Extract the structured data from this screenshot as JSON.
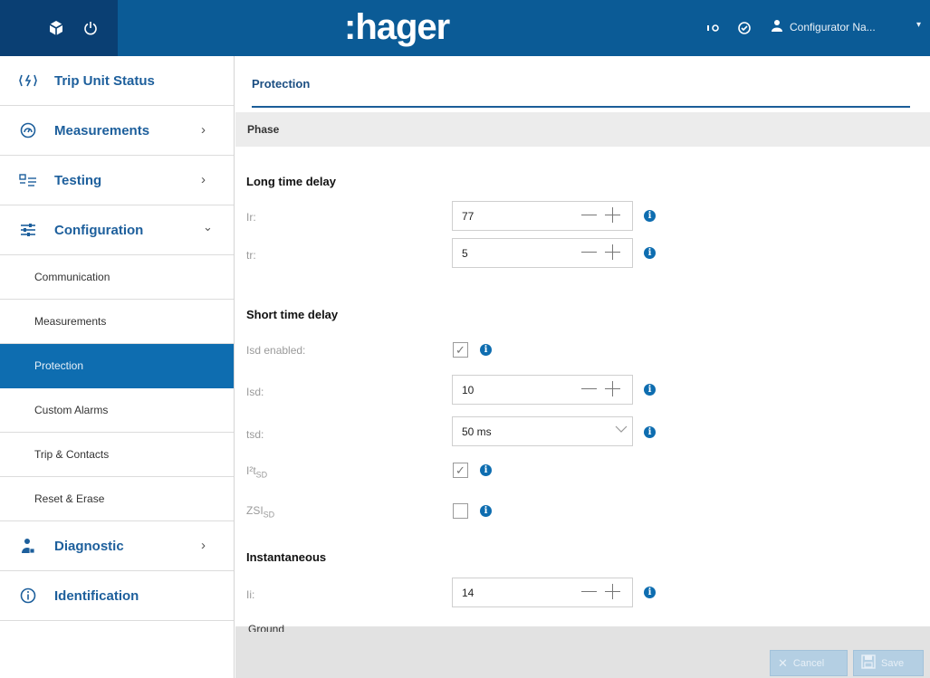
{
  "header": {
    "brand": ":hager",
    "user_name": "Configurator Na...",
    "icons": [
      "package-icon",
      "power-icon",
      "io-icon",
      "check-circle-icon",
      "user-icon",
      "caret-down-icon"
    ]
  },
  "sidebar": {
    "items": [
      {
        "label": "Trip Unit Status",
        "icon": "trip-unit-status-icon",
        "has_chevron": false
      },
      {
        "label": "Measurements",
        "icon": "measurements-gauge-icon",
        "has_chevron": true
      },
      {
        "label": "Testing",
        "icon": "testing-icon",
        "has_chevron": true
      },
      {
        "label": "Configuration",
        "icon": "sliders-icon",
        "has_chevron": true,
        "expanded": true
      },
      {
        "label": "Diagnostic",
        "icon": "diagnostic-user-icon",
        "has_chevron": true
      },
      {
        "label": "Identification",
        "icon": "info-circle-icon",
        "has_chevron": false
      }
    ],
    "subitems": [
      {
        "label": "Communication"
      },
      {
        "label": "Measurements"
      },
      {
        "label": "Protection",
        "active": true
      },
      {
        "label": "Custom Alarms"
      },
      {
        "label": "Trip & Contacts"
      },
      {
        "label": "Reset & Erase"
      }
    ]
  },
  "main": {
    "tab_title": "Protection",
    "section": "Phase",
    "long_time_delay": {
      "title": "Long time delay",
      "ir": {
        "label": "Ir:",
        "value": "77"
      },
      "tr": {
        "label": "tr:",
        "value": "5"
      }
    },
    "short_time_delay": {
      "title": "Short time delay",
      "isd_enabled": {
        "label": "Isd enabled:",
        "checked": true
      },
      "isd": {
        "label": "Isd:",
        "value": "10"
      },
      "tsd": {
        "label": "tsd:",
        "value": "50 ms"
      },
      "i2t_sd": {
        "label_main": "I²t",
        "label_sub": "SD",
        "checked": true
      },
      "zsi_sd": {
        "label_main": "ZSI",
        "label_sub": "SD",
        "checked": false
      }
    },
    "instantaneous": {
      "title": "Instantaneous",
      "ii": {
        "label": "Ii:",
        "value": "14"
      }
    },
    "next_section_cut": "Ground"
  },
  "footer": {
    "cancel_label": "Cancel",
    "save_label": "Save"
  },
  "colors": {
    "topbar": "#0b5b96",
    "topbar_dark": "#0a3f73",
    "accent": "#0e6db0",
    "nav_text": "#1d5f9c"
  }
}
